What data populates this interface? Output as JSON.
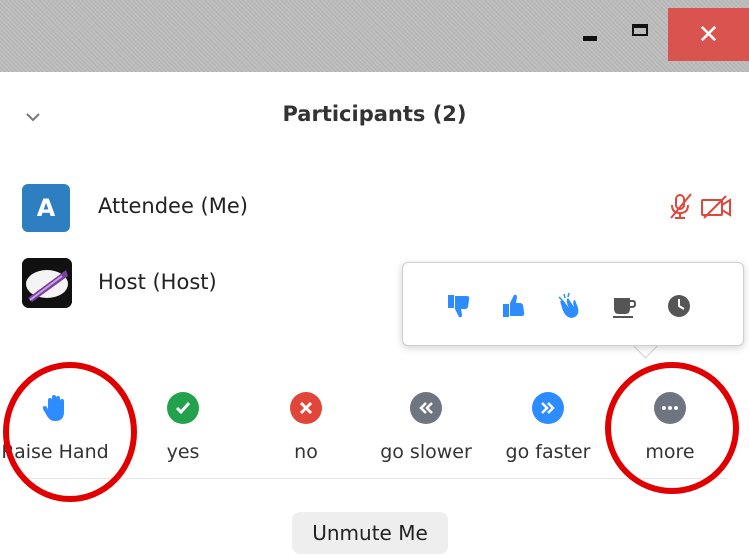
{
  "panel": {
    "title": "Participants (2)"
  },
  "participants": [
    {
      "avatar_letter": "A",
      "name": "Attendee (Me)",
      "avatar_color": "#2d7fc1",
      "audio": "mic-muted-icon",
      "video": "video-off-icon"
    },
    {
      "name": "Host (Host)",
      "avatar": "host-avatar-image"
    }
  ],
  "reactions": [
    {
      "icon": "thumbs-down-icon"
    },
    {
      "icon": "thumbs-up-icon"
    },
    {
      "icon": "clap-icon"
    },
    {
      "icon": "coffee-icon"
    },
    {
      "icon": "clock-icon"
    }
  ],
  "feedback": [
    {
      "label": "Raise Hand",
      "icon": "raise-hand-icon",
      "color": "#2d8cff"
    },
    {
      "label": "yes",
      "icon": "check-icon",
      "color": "#23a24d"
    },
    {
      "label": "no",
      "icon": "x-icon",
      "color": "#e0473a"
    },
    {
      "label": "go slower",
      "icon": "rewind-icon",
      "color": "#6e7480"
    },
    {
      "label": "go faster",
      "icon": "fast-forward-icon",
      "color": "#2d8cff"
    },
    {
      "label": "more",
      "icon": "more-icon",
      "color": "#6e7480"
    }
  ],
  "unmute_label": "Unmute Me",
  "colors": {
    "accent": "#2d8cff",
    "muted_red": "#e0473a",
    "annotation_red": "#e00000"
  }
}
